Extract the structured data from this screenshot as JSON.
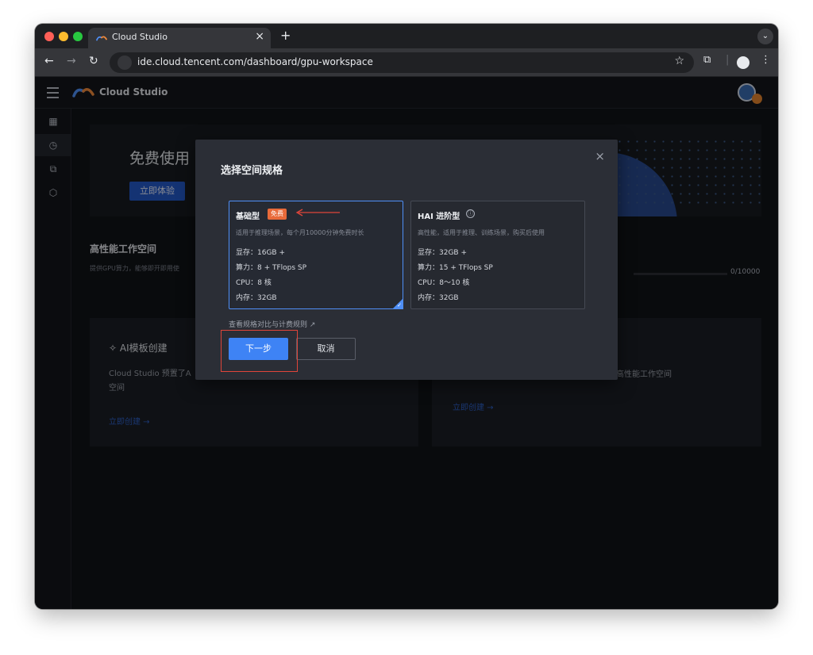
{
  "browser": {
    "tab_title": "Cloud Studio",
    "tab_close": "×",
    "new_tab": "+",
    "url": "ide.cloud.tencent.com/dashboard/gpu-workspace",
    "colors": {
      "red": "#ff5f57",
      "yellow": "#febc2e",
      "green": "#28c840"
    }
  },
  "app": {
    "brand": "Cloud Studio",
    "banner_title": "免费使用 GP",
    "banner_button": "立即体验",
    "section_title": "高性能工作空间",
    "section_desc": "提供GPU算力，能够即开即用使",
    "quota": "0/10000",
    "card_left": {
      "title": "AI模板创建",
      "desc": "Cloud Studio 预置了A 空间",
      "link": "立即创建 →"
    },
    "card_right": {
      "desc": "高性能工作空间",
      "link": "立即创建 →"
    }
  },
  "modal": {
    "title": "选择空间规格",
    "close": "×",
    "plans": [
      {
        "name": "基础型",
        "badge": "免费",
        "desc": "适用于推理场景，每个月10000分钟免费时长",
        "specs": [
          "显存：16GB +",
          "算力：8 + TFlops SP",
          "CPU：8 核",
          "内存：32GB"
        ]
      },
      {
        "name": "HAI 进阶型",
        "info_icon": "ⓘ",
        "desc": "高性能，适用于推理、训练场景，购买后使用",
        "specs": [
          "显存：32GB +",
          "算力：15 + TFlops SP",
          "CPU：8～10 核",
          "内存：32GB"
        ]
      }
    ],
    "compare_link": "查看规格对比与计费规则 ↗",
    "next_button": "下一步",
    "cancel_button": "取消",
    "accent": "#3e83f5",
    "badge_color": "#e86a3a",
    "highlight_color": "#e0453a"
  }
}
